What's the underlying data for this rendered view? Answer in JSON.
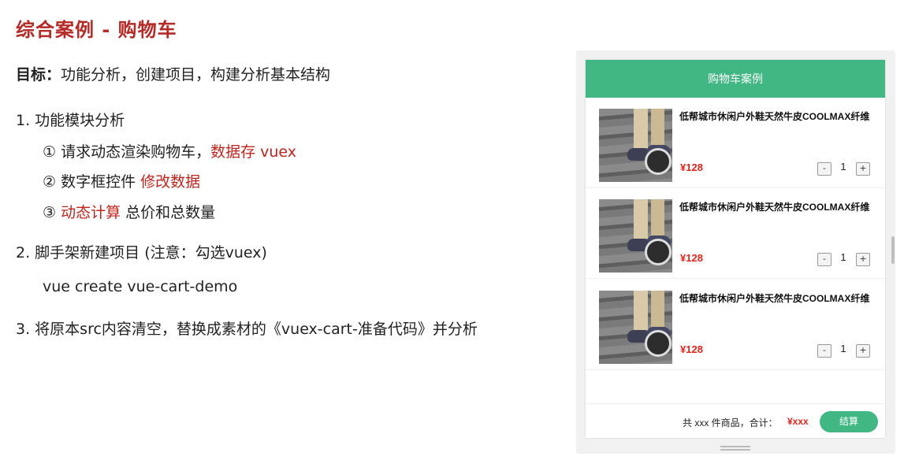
{
  "slide": {
    "title": "综合案例 - 购物车",
    "goal_label": "目标：",
    "goal_text": "功能分析，创建项目，构建分析基本结构",
    "step1": "1. 功能模块分析",
    "step1a_text": "① 请求动态渲染购物车，",
    "step1a_red": "数据存 vuex",
    "step1b_text": "② 数字框控件 ",
    "step1b_red": "修改数据",
    "step1c_prefix": "③ ",
    "step1c_red": "动态计算",
    "step1c_text": " 总价和总数量",
    "step2": "2. 脚手架新建项目 (注意：勾选vuex)",
    "step2_cmd": "vue create vue-cart-demo",
    "step3": "3. 将原本src内容清空，替换成素材的《vuex-cart-准备代码》并分析"
  },
  "cart": {
    "header": "购物车案例",
    "items": [
      {
        "title": "低帮城市休闲户外鞋天然牛皮COOLMAX纤维",
        "price": "¥128",
        "count": "1",
        "minus": "-",
        "plus": "+",
        "image": "shoe-photo"
      },
      {
        "title": "低帮城市休闲户外鞋天然牛皮COOLMAX纤维",
        "price": "¥128",
        "count": "1",
        "minus": "-",
        "plus": "+",
        "image": "shoe-photo"
      },
      {
        "title": "低帮城市休闲户外鞋天然牛皮COOLMAX纤维",
        "price": "¥128",
        "count": "1",
        "minus": "-",
        "plus": "+",
        "image": "shoe-photo"
      }
    ],
    "footer_text": "共 xxx 件商品，合计：",
    "footer_total": "¥xxx",
    "checkout": "结算",
    "accent_color": "#41b883",
    "price_color": "#e2231a"
  }
}
